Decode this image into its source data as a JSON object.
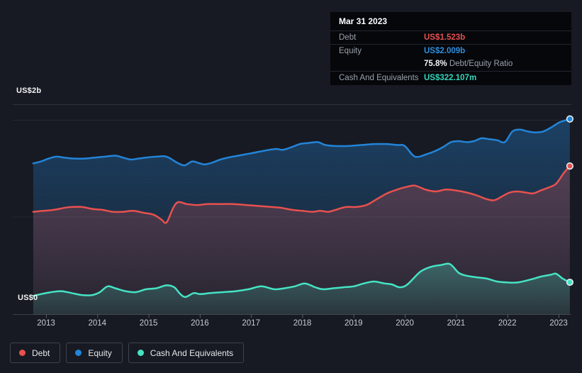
{
  "axis": {
    "top_label": "US$2b",
    "bottom_label": "US$0"
  },
  "tooltip": {
    "title": "Mar 31 2023",
    "rows": {
      "debt": {
        "label": "Debt",
        "value": "US$1.523b"
      },
      "equity": {
        "label": "Equity",
        "value": "US$2.009b"
      },
      "ratio": {
        "value": "75.8%",
        "label": "Debt/Equity Ratio"
      },
      "cash": {
        "label": "Cash And Equivalents",
        "value": "US$322.107m"
      }
    }
  },
  "legend": {
    "position": "bottom-left",
    "items": [
      {
        "label": "Debt",
        "color": "#e8514f"
      },
      {
        "label": "Equity",
        "color": "#2384d8"
      },
      {
        "label": "Cash And Equivalents",
        "color": "#45e3c4"
      }
    ]
  },
  "colors": {
    "background": "#171a22",
    "tooltip_background": "#05070b",
    "debt": "#e8514f",
    "equity": "#2384d8",
    "cash": "#45e3c4"
  },
  "chart_data": {
    "type": "area",
    "units": "US$ billions",
    "x_ticks": [
      2013,
      2014,
      2015,
      2016,
      2017,
      2018,
      2019,
      2020,
      2021,
      2022,
      2023
    ],
    "x_range": [
      2012.75,
      2023.25
    ],
    "ylim": [
      0,
      2.16
    ],
    "y_gridlines": [
      2,
      1,
      0
    ],
    "grid": true,
    "legend_position": "bottom",
    "series": [
      {
        "name": "Debt",
        "color": "#e8514f",
        "points": [
          [
            2012.75,
            1.05
          ],
          [
            2012.95,
            1.06
          ],
          [
            2013.15,
            1.07
          ],
          [
            2013.35,
            1.09
          ],
          [
            2013.5,
            1.1
          ],
          [
            2013.7,
            1.1
          ],
          [
            2013.9,
            1.08
          ],
          [
            2014.1,
            1.07
          ],
          [
            2014.3,
            1.05
          ],
          [
            2014.5,
            1.05
          ],
          [
            2014.7,
            1.06
          ],
          [
            2014.9,
            1.04
          ],
          [
            2015.1,
            1.02
          ],
          [
            2015.25,
            0.97
          ],
          [
            2015.35,
            0.94
          ],
          [
            2015.48,
            1.09
          ],
          [
            2015.58,
            1.15
          ],
          [
            2015.75,
            1.13
          ],
          [
            2015.95,
            1.12
          ],
          [
            2016.15,
            1.13
          ],
          [
            2016.4,
            1.13
          ],
          [
            2016.65,
            1.13
          ],
          [
            2016.9,
            1.12
          ],
          [
            2017.15,
            1.11
          ],
          [
            2017.4,
            1.1
          ],
          [
            2017.6,
            1.09
          ],
          [
            2017.8,
            1.07
          ],
          [
            2018.0,
            1.06
          ],
          [
            2018.2,
            1.05
          ],
          [
            2018.35,
            1.06
          ],
          [
            2018.5,
            1.05
          ],
          [
            2018.65,
            1.07
          ],
          [
            2018.85,
            1.1
          ],
          [
            2019.05,
            1.1
          ],
          [
            2019.25,
            1.12
          ],
          [
            2019.45,
            1.18
          ],
          [
            2019.65,
            1.24
          ],
          [
            2019.85,
            1.28
          ],
          [
            2020.05,
            1.31
          ],
          [
            2020.2,
            1.32
          ],
          [
            2020.4,
            1.28
          ],
          [
            2020.6,
            1.26
          ],
          [
            2020.8,
            1.28
          ],
          [
            2021.0,
            1.27
          ],
          [
            2021.2,
            1.25
          ],
          [
            2021.4,
            1.22
          ],
          [
            2021.6,
            1.18
          ],
          [
            2021.75,
            1.17
          ],
          [
            2021.9,
            1.21
          ],
          [
            2022.05,
            1.25
          ],
          [
            2022.2,
            1.26
          ],
          [
            2022.35,
            1.25
          ],
          [
            2022.5,
            1.24
          ],
          [
            2022.65,
            1.27
          ],
          [
            2022.8,
            1.3
          ],
          [
            2022.95,
            1.34
          ],
          [
            2023.1,
            1.45
          ],
          [
            2023.22,
            1.523
          ]
        ]
      },
      {
        "name": "Equity",
        "color": "#2384d8",
        "points": [
          [
            2012.75,
            1.55
          ],
          [
            2012.9,
            1.57
          ],
          [
            2013.05,
            1.6
          ],
          [
            2013.2,
            1.62
          ],
          [
            2013.35,
            1.61
          ],
          [
            2013.55,
            1.6
          ],
          [
            2013.75,
            1.6
          ],
          [
            2013.95,
            1.61
          ],
          [
            2014.15,
            1.62
          ],
          [
            2014.35,
            1.63
          ],
          [
            2014.5,
            1.61
          ],
          [
            2014.65,
            1.59
          ],
          [
            2014.8,
            1.6
          ],
          [
            2014.95,
            1.61
          ],
          [
            2015.15,
            1.62
          ],
          [
            2015.35,
            1.62
          ],
          [
            2015.55,
            1.56
          ],
          [
            2015.7,
            1.53
          ],
          [
            2015.85,
            1.57
          ],
          [
            2016.0,
            1.55
          ],
          [
            2016.1,
            1.54
          ],
          [
            2016.25,
            1.56
          ],
          [
            2016.4,
            1.59
          ],
          [
            2016.55,
            1.61
          ],
          [
            2016.75,
            1.63
          ],
          [
            2016.95,
            1.65
          ],
          [
            2017.15,
            1.67
          ],
          [
            2017.35,
            1.69
          ],
          [
            2017.5,
            1.7
          ],
          [
            2017.62,
            1.69
          ],
          [
            2017.8,
            1.72
          ],
          [
            2017.95,
            1.75
          ],
          [
            2018.1,
            1.76
          ],
          [
            2018.3,
            1.77
          ],
          [
            2018.45,
            1.74
          ],
          [
            2018.65,
            1.73
          ],
          [
            2018.9,
            1.73
          ],
          [
            2019.15,
            1.74
          ],
          [
            2019.4,
            1.75
          ],
          [
            2019.65,
            1.75
          ],
          [
            2019.85,
            1.74
          ],
          [
            2020.0,
            1.73
          ],
          [
            2020.2,
            1.62
          ],
          [
            2020.45,
            1.65
          ],
          [
            2020.6,
            1.68
          ],
          [
            2020.75,
            1.72
          ],
          [
            2020.9,
            1.77
          ],
          [
            2021.05,
            1.78
          ],
          [
            2021.2,
            1.77
          ],
          [
            2021.35,
            1.78
          ],
          [
            2021.5,
            1.81
          ],
          [
            2021.65,
            1.8
          ],
          [
            2021.8,
            1.79
          ],
          [
            2021.95,
            1.77
          ],
          [
            2022.1,
            1.88
          ],
          [
            2022.25,
            1.9
          ],
          [
            2022.4,
            1.88
          ],
          [
            2022.55,
            1.87
          ],
          [
            2022.7,
            1.88
          ],
          [
            2022.85,
            1.92
          ],
          [
            2023.0,
            1.97
          ],
          [
            2023.1,
            1.99
          ],
          [
            2023.22,
            2.009
          ]
        ]
      },
      {
        "name": "Cash And Equivalents",
        "color": "#45e3c4",
        "points": [
          [
            2012.75,
            0.18
          ],
          [
            2012.9,
            0.2
          ],
          [
            2013.1,
            0.22
          ],
          [
            2013.3,
            0.23
          ],
          [
            2013.5,
            0.21
          ],
          [
            2013.7,
            0.19
          ],
          [
            2013.9,
            0.19
          ],
          [
            2014.05,
            0.22
          ],
          [
            2014.2,
            0.28
          ],
          [
            2014.35,
            0.26
          ],
          [
            2014.55,
            0.23
          ],
          [
            2014.75,
            0.22
          ],
          [
            2014.95,
            0.25
          ],
          [
            2015.15,
            0.26
          ],
          [
            2015.35,
            0.29
          ],
          [
            2015.5,
            0.27
          ],
          [
            2015.62,
            0.2
          ],
          [
            2015.72,
            0.17
          ],
          [
            2015.88,
            0.21
          ],
          [
            2016.0,
            0.2
          ],
          [
            2016.2,
            0.21
          ],
          [
            2016.45,
            0.22
          ],
          [
            2016.7,
            0.23
          ],
          [
            2016.95,
            0.25
          ],
          [
            2017.2,
            0.28
          ],
          [
            2017.45,
            0.25
          ],
          [
            2017.65,
            0.26
          ],
          [
            2017.85,
            0.28
          ],
          [
            2018.05,
            0.31
          ],
          [
            2018.25,
            0.27
          ],
          [
            2018.4,
            0.25
          ],
          [
            2018.6,
            0.26
          ],
          [
            2018.8,
            0.27
          ],
          [
            2019.0,
            0.28
          ],
          [
            2019.2,
            0.31
          ],
          [
            2019.4,
            0.33
          ],
          [
            2019.6,
            0.31
          ],
          [
            2019.75,
            0.3
          ],
          [
            2019.9,
            0.27
          ],
          [
            2020.05,
            0.3
          ],
          [
            2020.3,
            0.43
          ],
          [
            2020.5,
            0.48
          ],
          [
            2020.7,
            0.5
          ],
          [
            2020.88,
            0.51
          ],
          [
            2021.05,
            0.42
          ],
          [
            2021.2,
            0.39
          ],
          [
            2021.45,
            0.37
          ],
          [
            2021.6,
            0.36
          ],
          [
            2021.8,
            0.33
          ],
          [
            2022.0,
            0.32
          ],
          [
            2022.2,
            0.32
          ],
          [
            2022.45,
            0.35
          ],
          [
            2022.65,
            0.38
          ],
          [
            2022.85,
            0.4
          ],
          [
            2022.95,
            0.41
          ],
          [
            2023.08,
            0.36
          ],
          [
            2023.22,
            0.322
          ]
        ]
      }
    ]
  }
}
